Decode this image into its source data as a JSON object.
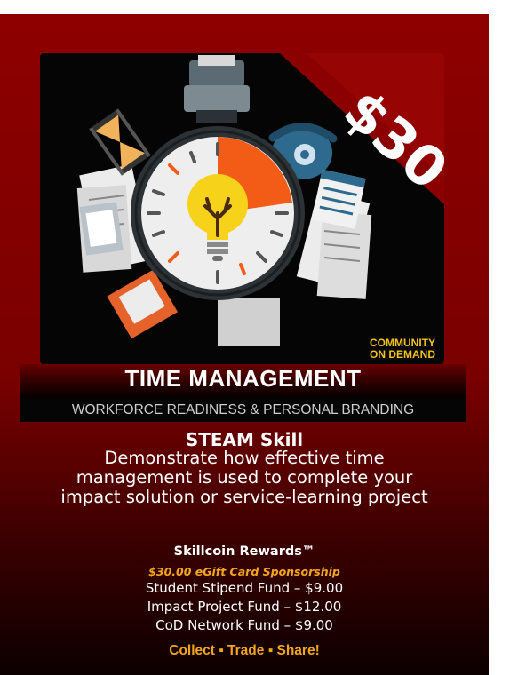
{
  "price": "$30",
  "logo": {
    "line1": "COMMUNITY",
    "line2": "ON DEMAND"
  },
  "title": "TIME MANAGEMENT",
  "subtitle": "WORKFORCE READINESS & PERSONAL BRANDING",
  "skill_heading": "STEAM Skill",
  "description": "Demonstrate how effective time management is used to complete your impact solution or service-learning project",
  "rewards": {
    "heading": "Skillcoin Rewards™",
    "sponsorship": "$30.00 eGift Card Sponsorship",
    "funds": [
      "Student Stipend Fund – $9.00",
      "Impact Project Fund – $12.00",
      "CoD Network Fund – $9.00"
    ]
  },
  "call_to_action": "Collect ▪ Trade ▪ Share!",
  "colors": {
    "accent_orange": "#f3a51d",
    "card_red": "#8e0000",
    "bulb_yellow": "#f6d21a"
  }
}
